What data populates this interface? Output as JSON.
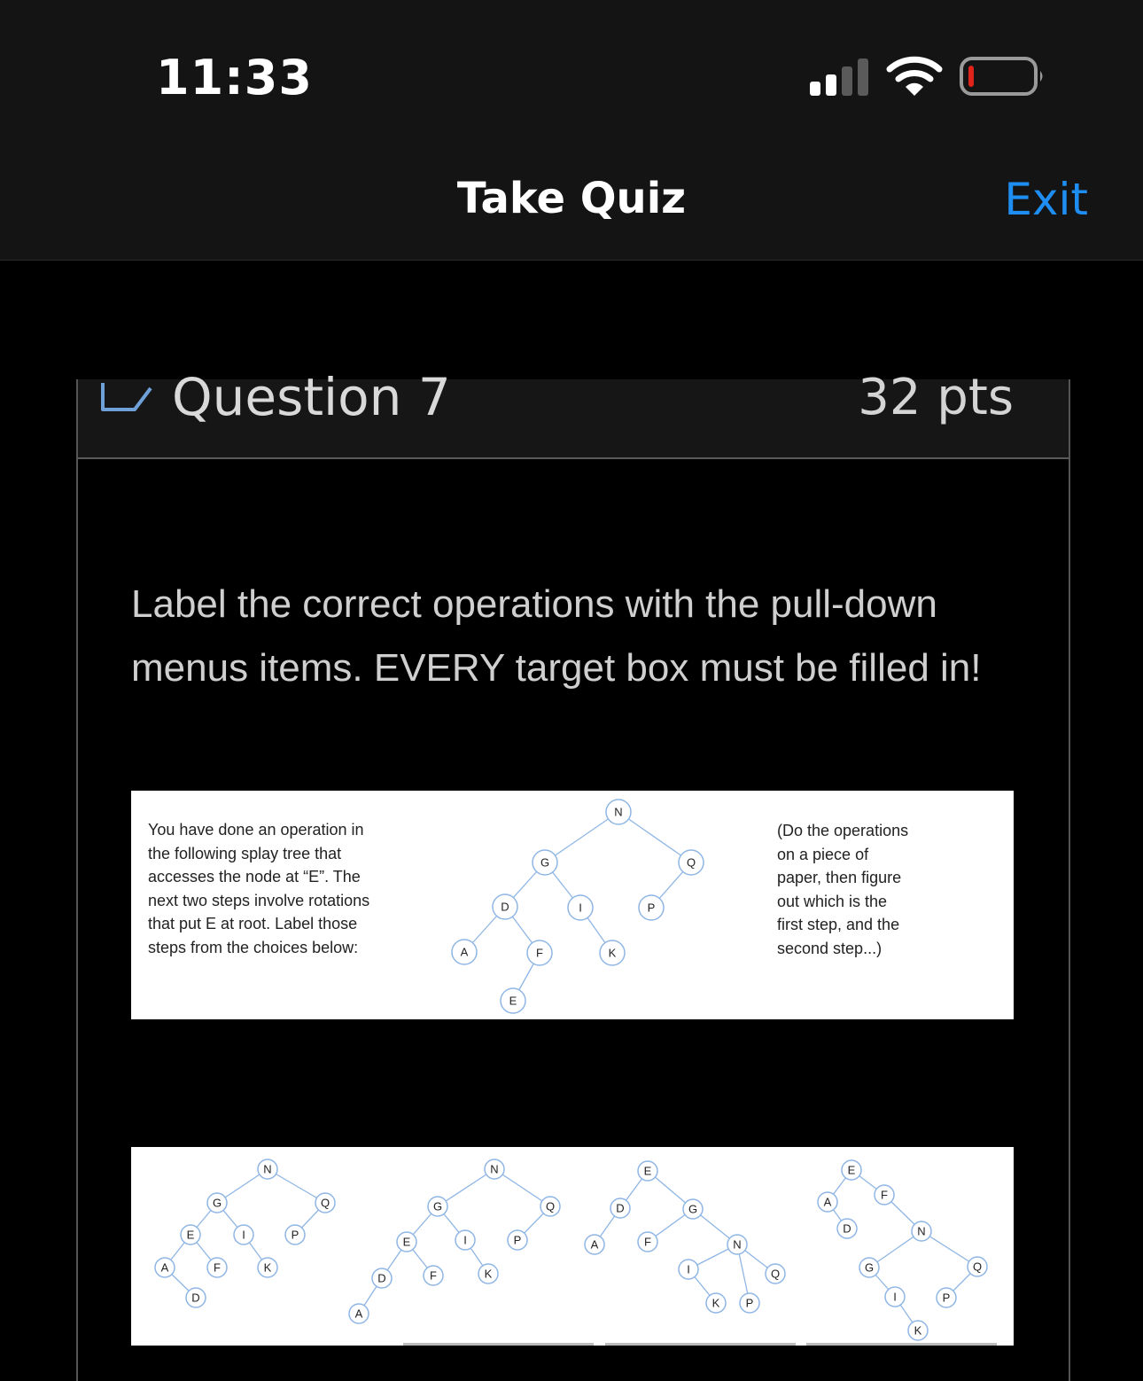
{
  "status_bar": {
    "time": "11:33",
    "signal_icon": "cellular-signal-icon",
    "wifi_icon": "wifi-icon",
    "battery_icon": "battery-low-icon",
    "battery_color": "#e0241c"
  },
  "nav": {
    "title": "Take Quiz",
    "exit_label": "Exit",
    "accent_color": "#1f8ef2"
  },
  "question": {
    "flag_icon": "flag-outline-icon",
    "title": "Question 7",
    "points": "32 pts",
    "prompt": "Label the correct operations with the pull-down menus items.  EVERY target box must be filled in!",
    "figure": {
      "intro_text": "You have done an operation in\nthe following splay tree that\naccesses the node at “E”.  The\nnext two steps involve rotations\nthat put E at root.  Label those\nsteps from the choices below:",
      "note_text": "(Do the operations\non a piece of\npaper, then figure\nout which is the\nfirst step, and the\nsecond step...)",
      "main_tree_labels": [
        "N",
        "G",
        "Q",
        "D",
        "I",
        "P",
        "A",
        "F",
        "K",
        "E"
      ],
      "choice_trees": [
        {
          "labels": [
            "N",
            "G",
            "Q",
            "E",
            "I",
            "P",
            "A",
            "F",
            "K",
            "D"
          ]
        },
        {
          "labels": [
            "N",
            "G",
            "Q",
            "E",
            "I",
            "P",
            "D",
            "F",
            "K",
            "A"
          ]
        },
        {
          "labels": [
            "E",
            "D",
            "G",
            "A",
            "F",
            "N",
            "I",
            "Q",
            "K",
            "P"
          ]
        },
        {
          "labels": [
            "E",
            "A",
            "F",
            "D",
            "N",
            "G",
            "Q",
            "I",
            "P",
            "K"
          ]
        }
      ]
    }
  }
}
